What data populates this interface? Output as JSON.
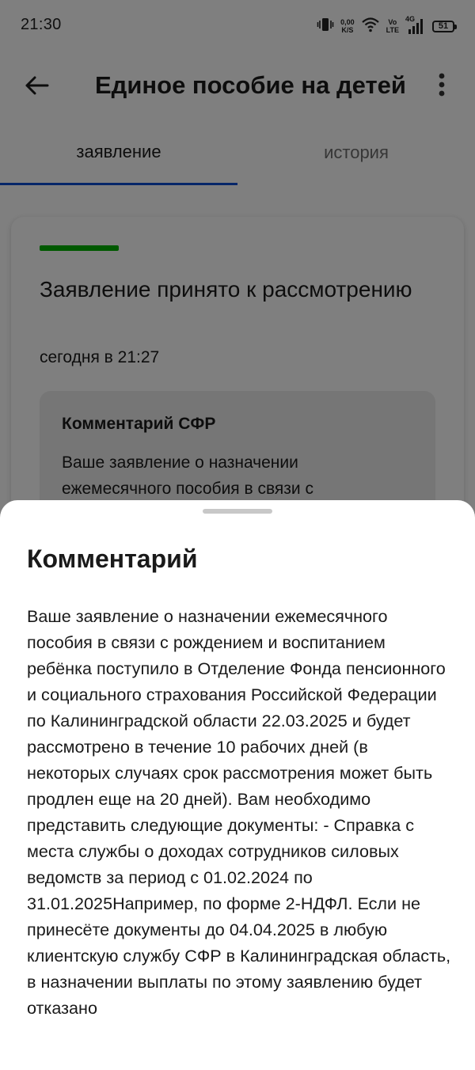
{
  "status_bar": {
    "time": "21:30",
    "net_speed_value": "0,00",
    "net_speed_unit": "K/S",
    "volte_top": "Vo",
    "volte_bottom": "LTE",
    "network": "4G",
    "battery": "51"
  },
  "app_bar": {
    "title": "Единое пособие на детей"
  },
  "tabs": [
    {
      "label": "заявление",
      "active": true
    },
    {
      "label": "история",
      "active": false
    }
  ],
  "card": {
    "status_color": "#00b300",
    "title": "Заявление принято к рассмотрению",
    "date": "сегодня в 21:27",
    "comment_box": {
      "title": "Комментарий СФР",
      "text": "Ваше заявление о назначении ежемесячного пособия в связи с"
    }
  },
  "sheet": {
    "title": "Комментарий",
    "text": "Ваше заявление о назначении ежемесячного пособия в связи с рождением и воспитанием ребёнка поступило в Отделение Фонда пенсионного и социального страхования Российской Федерации по Калининградской области 22.03.2025 и будет рассмотрено в течение 10 рабочих дней (в некоторых случаях срок рассмотрения может быть продлен еще на 20 дней). Вам необходимо представить следующие документы: - Справка с места службы о доходах сотрудников силовых ведомств за период с 01.02.2024 по 31.01.2025Например, по форме 2-НДФЛ. Если не принесёте документы до 04.04.2025 в любую клиентскую службу СФР в Калининградская область, в назначении выплаты по этому заявлению будет отказано"
  },
  "colors": {
    "accent": "#0d4cd3",
    "success": "#00b300"
  }
}
